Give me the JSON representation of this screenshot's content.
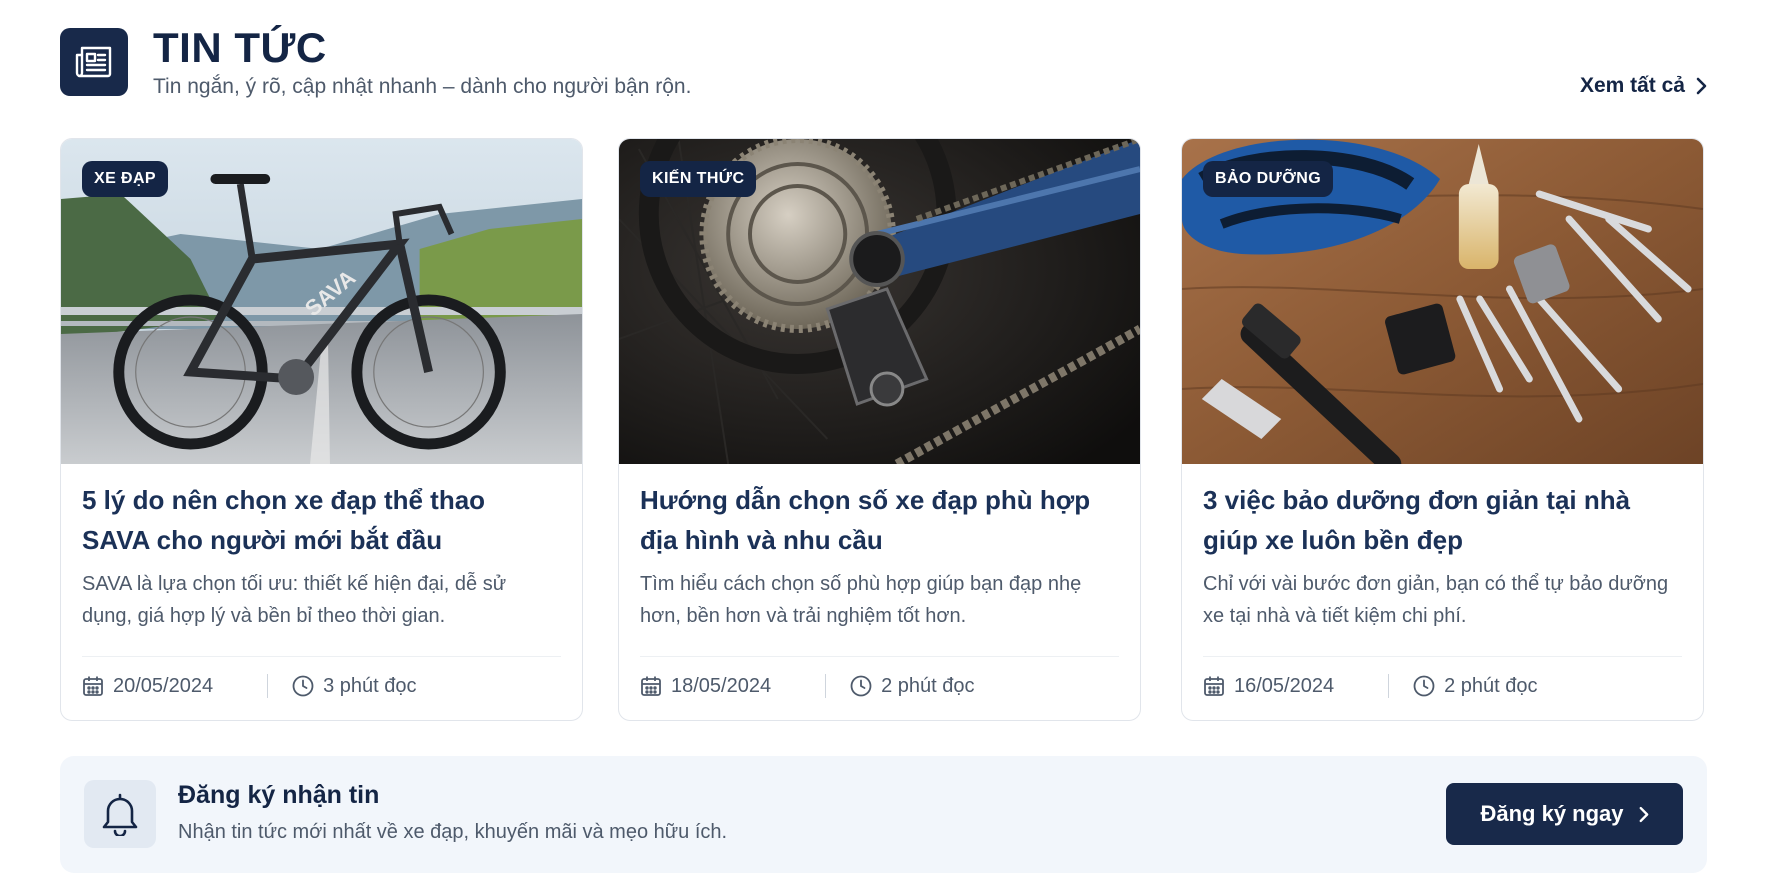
{
  "header": {
    "title": "TIN TỨC",
    "subtitle": "Tin ngắn, ý rõ, cập nhật nhanh – dành cho người bận rộn.",
    "see_all_label": "Xem tất cả",
    "icon": "newspaper-icon"
  },
  "articles": [
    {
      "category": "XE ĐẠP",
      "title": "5 lý do nên chọn xe đạp thể thao SAVA cho người mới bắt đầu",
      "description": "SAVA là lựa chọn tối ưu: thiết kế hiện đại, dễ sử dụng, giá hợp lý và bền bỉ theo thời gian.",
      "date": "20/05/2024",
      "read_time": "3 phút đọc",
      "image": "road-bike-photo",
      "image_text": "SAVA"
    },
    {
      "category": "KIẾN THỨC",
      "title": "Hướng dẫn chọn số xe đạp phù hợp địa hình và nhu cầu",
      "description": "Tìm hiểu cách chọn số phù hợp giúp bạn đạp nhẹ hơn, bền hơn và trải nghiệm tốt hơn.",
      "date": "18/05/2024",
      "read_time": "2 phút đọc",
      "image": "rear-derailleur-cassette-photo"
    },
    {
      "category": "BẢO DƯỠNG",
      "title": "3 việc bảo dưỡng đơn giản tại nhà giúp xe luôn bền đẹp",
      "description": "Chỉ với vài bước đơn giản, bạn có thể tự bảo dưỡng xe tại nhà và tiết kiệm chi phí.",
      "date": "16/05/2024",
      "read_time": "2 phút đọc",
      "image": "helmet-tools-photo"
    }
  ],
  "newsletter": {
    "title": "Đăng ký nhận tin",
    "subtitle": "Nhận tin tức mới nhất về xe đạp, khuyến mãi và mẹo hữu ích.",
    "button_label": "Đăng ký ngay",
    "icon": "bell-icon"
  },
  "colors": {
    "primary": "#18294a",
    "title_text": "#1b3157",
    "body_text": "#4e5a6b",
    "newsletter_bg": "#f2f6fb"
  }
}
